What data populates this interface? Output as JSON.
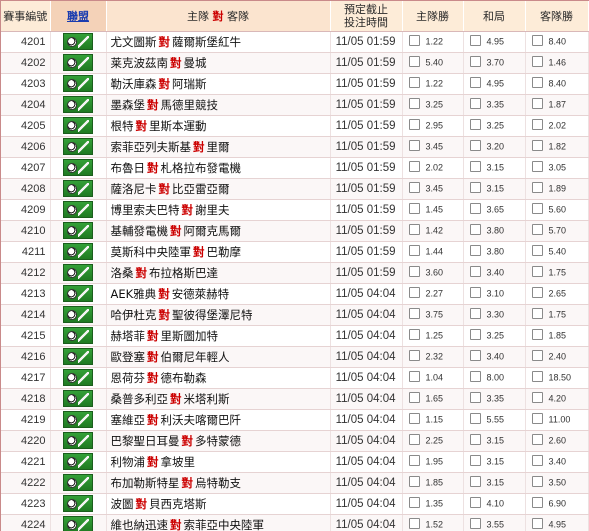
{
  "header": {
    "match_no": "賽事編號",
    "league": "聯盟",
    "home": "主隊",
    "vs": "對",
    "away": "客隊",
    "time_line1": "預定截止",
    "time_line2": "投注時間",
    "home_win": "主隊勝",
    "draw": "和局",
    "away_win": "客隊勝"
  },
  "colors": {
    "accent_red": "#cc0000",
    "league_link": "#1a3cb0",
    "header_bg": "#fdecd8",
    "league_icon": "#2a8a2e"
  },
  "rows": [
    {
      "id": "4201",
      "home": "尤文圖斯",
      "away": "薩爾斯堡紅牛",
      "time": "11/05 01:59",
      "h": "1.22",
      "d": "4.95",
      "a": "8.40"
    },
    {
      "id": "4202",
      "home": "莱克波茲南",
      "away": "曼城",
      "time": "11/05 01:59",
      "h": "5.40",
      "d": "3.70",
      "a": "1.46"
    },
    {
      "id": "4203",
      "home": "勒沃庫森",
      "away": "阿瑞斯",
      "time": "11/05 01:59",
      "h": "1.22",
      "d": "4.95",
      "a": "8.40"
    },
    {
      "id": "4204",
      "home": "墨森堡",
      "away": "馬德里競技",
      "time": "11/05 01:59",
      "h": "3.25",
      "d": "3.35",
      "a": "1.87"
    },
    {
      "id": "4205",
      "home": "根特",
      "away": "里斯本運動",
      "time": "11/05 01:59",
      "h": "2.95",
      "d": "3.25",
      "a": "2.02"
    },
    {
      "id": "4206",
      "home": "索菲亞列夫斯基",
      "away": "里爾",
      "time": "11/05 01:59",
      "h": "3.45",
      "d": "3.20",
      "a": "1.82"
    },
    {
      "id": "4207",
      "home": "布魯日",
      "away": "札格拉布發電機",
      "time": "11/05 01:59",
      "h": "2.02",
      "d": "3.15",
      "a": "3.05"
    },
    {
      "id": "4208",
      "home": "薩洛尼卡",
      "away": "比亞雷亞爾",
      "time": "11/05 01:59",
      "h": "3.45",
      "d": "3.15",
      "a": "1.89"
    },
    {
      "id": "4209",
      "home": "博里索夫巴特",
      "away": "謝里夫",
      "time": "11/05 01:59",
      "h": "1.45",
      "d": "3.65",
      "a": "5.60"
    },
    {
      "id": "4210",
      "home": "基輔發電機",
      "away": "阿爾克馬爾",
      "time": "11/05 01:59",
      "h": "1.42",
      "d": "3.80",
      "a": "5.70"
    },
    {
      "id": "4211",
      "home": "莫斯科中央陸軍",
      "away": "巴勒摩",
      "time": "11/05 01:59",
      "h": "1.44",
      "d": "3.80",
      "a": "5.40"
    },
    {
      "id": "4212",
      "home": "洛桑",
      "away": "布拉格斯巴達",
      "time": "11/05 01:59",
      "h": "3.60",
      "d": "3.40",
      "a": "1.75"
    },
    {
      "id": "4213",
      "home": "AEK雅典",
      "away": "安德萊赫特",
      "time": "11/05 04:04",
      "h": "2.27",
      "d": "3.10",
      "a": "2.65"
    },
    {
      "id": "4214",
      "home": "哈伊杜克",
      "away": "聖彼得堡澤尼特",
      "time": "11/05 04:04",
      "h": "3.75",
      "d": "3.30",
      "a": "1.75"
    },
    {
      "id": "4215",
      "home": "赫塔菲",
      "away": "里斯圖加特",
      "time": "11/05 04:04",
      "h": "1.25",
      "d": "3.25",
      "a": "1.85"
    },
    {
      "id": "4216",
      "home": "歐登塞",
      "away": "伯爾尼年輕人",
      "time": "11/05 04:04",
      "h": "2.32",
      "d": "3.40",
      "a": "2.40"
    },
    {
      "id": "4217",
      "home": "恩荷芬",
      "away": "德布勒森",
      "time": "11/05 04:04",
      "h": "1.04",
      "d": "8.00",
      "a": "18.50"
    },
    {
      "id": "4218",
      "home": "桑普多利亞",
      "away": "米塔利斯",
      "time": "11/05 04:04",
      "h": "1.65",
      "d": "3.35",
      "a": "4.20"
    },
    {
      "id": "4219",
      "home": "塞維亞",
      "away": "利沃夫喀爾巴阡",
      "time": "11/05 04:04",
      "h": "1.15",
      "d": "5.55",
      "a": "11.00"
    },
    {
      "id": "4220",
      "home": "巴黎聖日耳曼",
      "away": "多特蒙德",
      "time": "11/05 04:04",
      "h": "2.25",
      "d": "3.15",
      "a": "2.60"
    },
    {
      "id": "4221",
      "home": "利物浦",
      "away": "拿坡里",
      "time": "11/05 04:04",
      "h": "1.95",
      "d": "3.15",
      "a": "3.40"
    },
    {
      "id": "4222",
      "home": "布加勒斯特星",
      "away": "烏特勒支",
      "time": "11/05 04:04",
      "h": "1.85",
      "d": "3.15",
      "a": "3.50"
    },
    {
      "id": "4223",
      "home": "波圖",
      "away": "貝西克塔斯",
      "time": "11/05 04:04",
      "h": "1.35",
      "d": "4.10",
      "a": "6.90"
    },
    {
      "id": "4224",
      "home": "維也納迅速",
      "away": "索菲亞中央陸軍",
      "time": "11/05 04:04",
      "h": "1.52",
      "d": "3.55",
      "a": "4.95"
    }
  ]
}
